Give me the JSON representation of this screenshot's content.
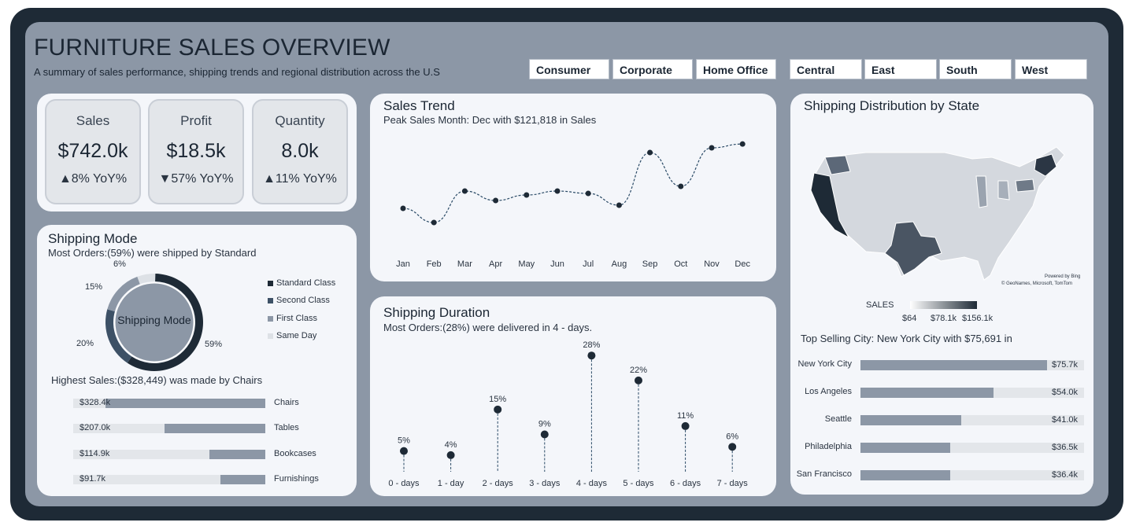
{
  "header": {
    "title": "FURNITURE SALES OVERVIEW",
    "subtitle": "A summary of sales performance, shipping trends and regional distribution across the U.S"
  },
  "segment_slicer": [
    "Consumer",
    "Corporate",
    "Home Office"
  ],
  "region_slicer": [
    "Central",
    "East",
    "South",
    "West"
  ],
  "kpis": [
    {
      "label": "Sales",
      "value": "$742.0k",
      "yoy": "▲8% YoY%"
    },
    {
      "label": "Profit",
      "value": "$18.5k",
      "yoy": "▼57% YoY%"
    },
    {
      "label": "Quantity",
      "value": "8.0k",
      "yoy": "▲11% YoY%"
    }
  ],
  "shipping_mode": {
    "title": "Shipping Mode",
    "subtitle": "Most Orders:(59%) were shipped by Standard",
    "center_label": "Shipping Mode",
    "slices": [
      {
        "name": "Standard Class",
        "pct": 59,
        "label": "59%",
        "color": "#1e2a36"
      },
      {
        "name": "Second Class",
        "pct": 20,
        "label": "20%",
        "color": "#3d5166"
      },
      {
        "name": "First Class",
        "pct": 15,
        "label": "15%",
        "color": "#8c97a6"
      },
      {
        "name": "Same Day",
        "pct": 6,
        "label": "6%",
        "color": "#dde1e6"
      }
    ]
  },
  "category_sales": {
    "subtitle": "Highest Sales:($328,449) was made by Chairs",
    "items": [
      {
        "name": "Chairs",
        "label": "$328.4k",
        "value": 328.4
      },
      {
        "name": "Tables",
        "label": "$207.0k",
        "value": 207.0
      },
      {
        "name": "Bookcases",
        "label": "$114.9k",
        "value": 114.9
      },
      {
        "name": "Furnishings",
        "label": "$91.7k",
        "value": 91.7
      }
    ],
    "max": 328.4
  },
  "sales_trend": {
    "title": "Sales Trend",
    "subtitle": "Peak Sales Month: Dec with $121,818 in Sales"
  },
  "shipping_duration": {
    "title": "Shipping Duration",
    "subtitle": "Most Orders:(28%) were delivered in 4 - days."
  },
  "shipping_state": {
    "title": "Shipping Distribution by State",
    "credit_1": "Powered by Bing",
    "credit_2": "© GeoNames, Microsoft, TomTom",
    "legend_title": "SALES",
    "legend_min": "$64",
    "legend_mid": "$78.1k",
    "legend_max": "$156.1k"
  },
  "top_cities": {
    "subtitle": "Top Selling City: New York City with $75,691 in",
    "items": [
      {
        "name": "New York City",
        "label": "$75.7k",
        "value": 75.7
      },
      {
        "name": "Los Angeles",
        "label": "$54.0k",
        "value": 54.0
      },
      {
        "name": "Seattle",
        "label": "$41.0k",
        "value": 41.0
      },
      {
        "name": "Philadelphia",
        "label": "$36.5k",
        "value": 36.5
      },
      {
        "name": "San Francisco",
        "label": "$36.4k",
        "value": 36.4
      }
    ],
    "max": 75.7
  },
  "colors": {
    "dark": "#1e2a36",
    "mid": "#8c97a6",
    "light": "#e3e6ea",
    "panel": "#f4f6fa"
  },
  "chart_data": [
    {
      "type": "line",
      "title": "Sales Trend",
      "categories": [
        "Jan",
        "Feb",
        "Mar",
        "Apr",
        "May",
        "Jun",
        "Jul",
        "Aug",
        "Sep",
        "Oct",
        "Nov",
        "Dec"
      ],
      "values": [
        40000,
        22000,
        62000,
        50000,
        57000,
        62000,
        59000,
        44000,
        111000,
        68000,
        117000,
        121818
      ],
      "ylim": [
        0,
        130000
      ],
      "grid": false,
      "line_style": "dashed"
    },
    {
      "type": "scatter",
      "title": "Shipping Duration",
      "categories": [
        "0 - days",
        "1 - day",
        "2 - days",
        "3 - days",
        "4 - days",
        "5 - days",
        "6 - days",
        "7 - days"
      ],
      "values": [
        5,
        4,
        15,
        9,
        28,
        22,
        11,
        6
      ],
      "labels": [
        "5%",
        "4%",
        "15%",
        "9%",
        "28%",
        "22%",
        "11%",
        "6%"
      ],
      "ylim": [
        0,
        30
      ],
      "style": "lollipop"
    }
  ]
}
